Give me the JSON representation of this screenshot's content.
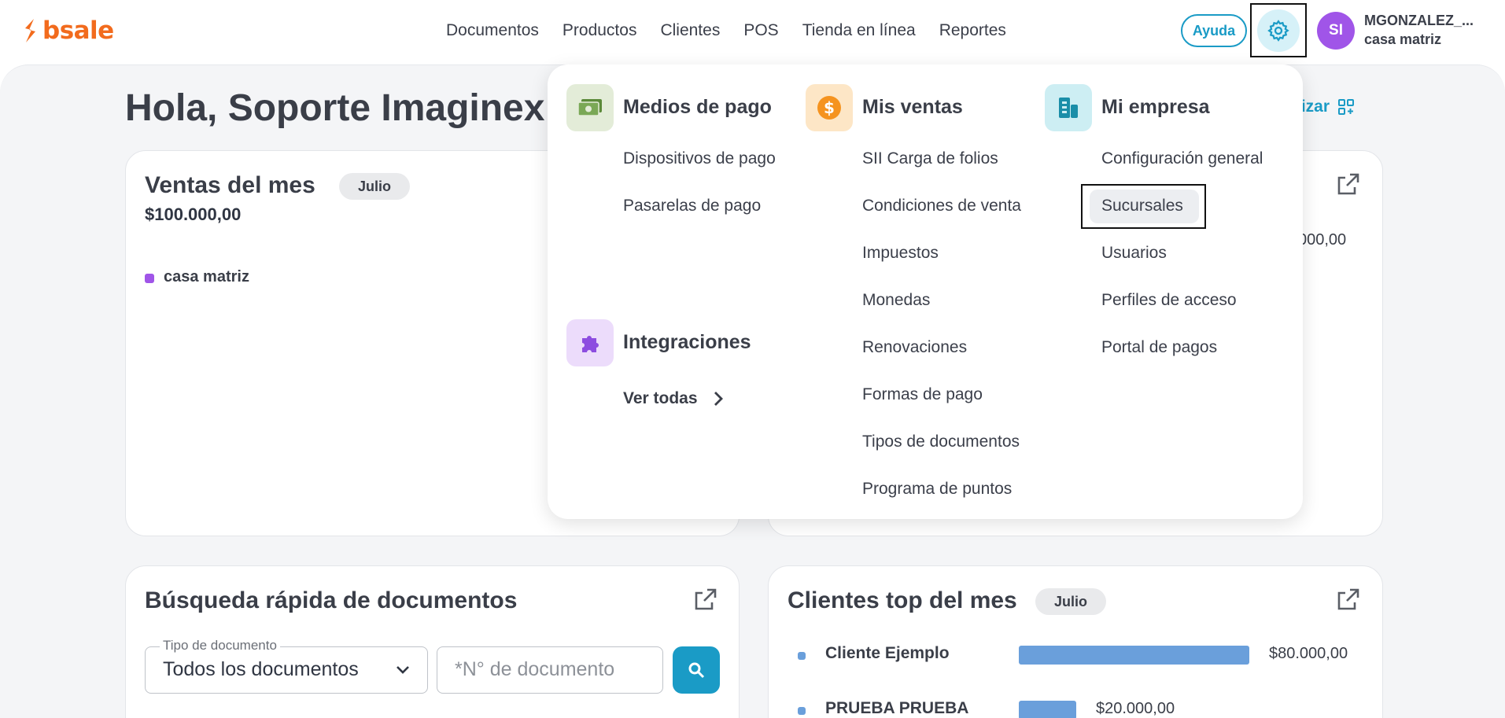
{
  "header": {
    "logo_text": "bsale",
    "nav": [
      "Documentos",
      "Productos",
      "Clientes",
      "POS",
      "Tienda en línea",
      "Reportes"
    ],
    "help_label": "Ayuda",
    "avatar_initials": "SI",
    "user_name": "MGONZALEZ_...",
    "user_branch": "casa matriz"
  },
  "dashboard": {
    "greeting": "Hola, Soporte Imaginex",
    "customize_label": "lizar",
    "sales_card": {
      "title": "Ventas del mes",
      "month_chip": "Julio",
      "total": "$100.000,00",
      "legend_label": "casa matriz",
      "legend_color": "#a055e8"
    },
    "right_card_amount": "000,00",
    "search_card": {
      "title": "Búsqueda rápida de documentos",
      "doc_type_label": "Tipo de documento",
      "doc_type_value": "Todos los documentos",
      "doc_number_placeholder": "*N° de documento"
    },
    "clients_card": {
      "title": "Clientes top del mes",
      "month_chip": "Julio",
      "clients": [
        {
          "name": "Cliente Ejemplo",
          "amount": "$80.000,00",
          "value": 80000
        },
        {
          "name": "PRUEBA PRUEBA",
          "amount": "$20.000,00",
          "value": 20000
        }
      ],
      "bar_color": "#6a9fdb"
    }
  },
  "menu": {
    "payment": {
      "title": "Medios de pago",
      "items": [
        "Dispositivos de pago",
        "Pasarelas de pago"
      ]
    },
    "integrations": {
      "title": "Integraciones",
      "see_all": "Ver todas"
    },
    "sales": {
      "title": "Mis ventas",
      "items": [
        "SII Carga de folios",
        "Condiciones de venta",
        "Impuestos",
        "Monedas",
        "Renovaciones",
        "Formas de pago",
        "Tipos de documentos",
        "Programa de puntos"
      ]
    },
    "company": {
      "title": "Mi empresa",
      "items": [
        "Configuración general",
        "Sucursales",
        "Usuarios",
        "Perfiles de acceso",
        "Portal de pagos"
      ]
    },
    "icon_colors": {
      "payment_bg": "#e3ecd8",
      "sales_bg": "#fde6c6",
      "company_bg": "#cdeef3",
      "integrations_bg": "#ecdcfb"
    }
  }
}
